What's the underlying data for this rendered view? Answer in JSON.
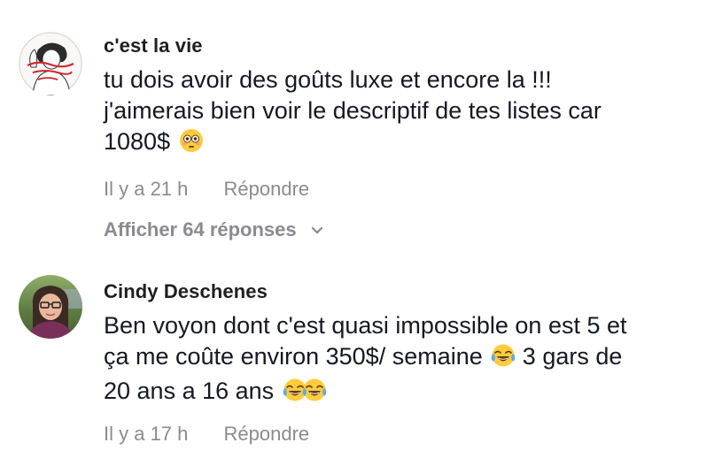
{
  "comments": [
    {
      "author": "c'est la vie",
      "text_line1": "tu dois avoir des goûts luxe et encore la !!!",
      "text_line2": "j'aimerais bien voir le descriptif de tes listes car",
      "text_line3": "1080$",
      "emoji_1": "flushed-face-emoji",
      "time": "Il y a 21 h",
      "reply_label": "Répondre",
      "view_replies_label": "Afficher 64 réponses",
      "avatar_icon": "illustrated-woman-avatar"
    },
    {
      "author": "Cindy Deschenes",
      "text_line1": "Ben voyon dont c'est quasi impossible on est 5 et",
      "text_line2a": "ça me coûte environ 350$/ semaine",
      "text_line2b": "3 gars de",
      "text_line3": "20 ans a 16 ans",
      "emoji_1": "tears-of-joy-emoji",
      "emoji_2": "tears-of-joy-emoji",
      "time": "Il y a 17 h",
      "reply_label": "Répondre",
      "avatar_icon": "profile-photo-avatar"
    }
  ],
  "colors": {
    "text_primary": "#161823",
    "text_secondary": "#8a8b91",
    "background": "#ffffff"
  }
}
